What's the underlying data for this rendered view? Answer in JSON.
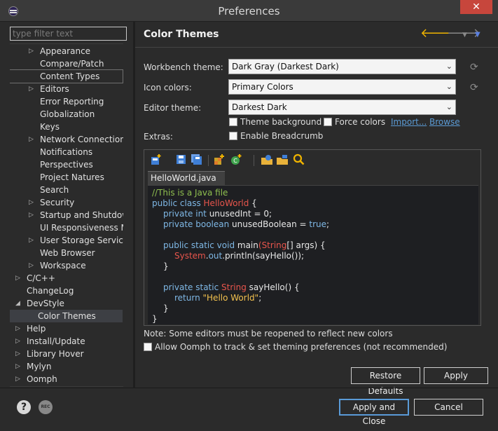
{
  "window": {
    "title": "Preferences",
    "close_label": "✕"
  },
  "filter": {
    "placeholder": "type filter text"
  },
  "tree": [
    {
      "label": "Appearance",
      "arrow": true
    },
    {
      "label": "Compare/Patch",
      "arrow": false
    },
    {
      "label": "Content Types",
      "arrow": false
    },
    {
      "label": "Editors",
      "arrow": true
    },
    {
      "label": "Error Reporting",
      "arrow": false
    },
    {
      "label": "Globalization",
      "arrow": false
    },
    {
      "label": "Keys",
      "arrow": false
    },
    {
      "label": "Network Connections",
      "arrow": true
    },
    {
      "label": "Notifications",
      "arrow": false
    },
    {
      "label": "Perspectives",
      "arrow": false
    },
    {
      "label": "Project Natures",
      "arrow": false
    },
    {
      "label": "Search",
      "arrow": false
    },
    {
      "label": "Security",
      "arrow": true
    },
    {
      "label": "Startup and Shutdown",
      "arrow": true
    },
    {
      "label": "UI Responsiveness Mc",
      "arrow": false
    },
    {
      "label": "User Storage Service",
      "arrow": true
    },
    {
      "label": "Web Browser",
      "arrow": false
    },
    {
      "label": "Workspace",
      "arrow": true
    },
    {
      "label": "C/C++",
      "arrow": true
    },
    {
      "label": "ChangeLog",
      "arrow": false
    },
    {
      "label": "DevStyle",
      "arrow": "open"
    },
    {
      "label": "Color Themes",
      "arrow": false
    },
    {
      "label": "Help",
      "arrow": true
    },
    {
      "label": "Install/Update",
      "arrow": true
    },
    {
      "label": "Library Hover",
      "arrow": true
    },
    {
      "label": "Mylyn",
      "arrow": true
    },
    {
      "label": "Oomph",
      "arrow": true
    }
  ],
  "page": {
    "title": "Color Themes",
    "workbench_theme_label": "Workbench theme:",
    "workbench_theme_value": "Dark Gray (Darkest Dark)",
    "icon_colors_label": "Icon colors:",
    "icon_colors_value": "Primary Colors",
    "editor_theme_label": "Editor theme:",
    "editor_theme_value": "Darkest Dark",
    "theme_background_label": "Theme background",
    "force_colors_label": "Force colors",
    "import_link": "Import...",
    "browse_link": "Browse",
    "extras_label": "Extras:",
    "enable_breadcrumb_label": "Enable Breadcrumb",
    "editor_tab": "HelloWorld.java",
    "note": "Note: Some editors must be reopened to reflect new colors",
    "allow_oomph_label": "Allow Oomph to track & set theming preferences (not recommended)",
    "restore_defaults": "Restore Defaults",
    "apply": "Apply"
  },
  "code": {
    "l1": "//This is a Java file",
    "l2a": "public class ",
    "l2b": "HelloWorld",
    "l2c": " {",
    "l3a": "private int ",
    "l3b": "unusedInt",
    "l3c": " = ",
    "l3d": "0",
    "l3e": ";",
    "l4a": "private boolean ",
    "l4b": "unusedBoolean",
    "l4c": " = ",
    "l4d": "true",
    "l4e": ";",
    "l5a": "public static void ",
    "l5b": "main",
    "l5c": "(",
    "l5d": "String",
    "l5e": "[] args) {",
    "l6a": "System",
    "l6b": ".",
    "l6c": "out",
    "l6d": ".println(sayHello());",
    "l7": "}",
    "l8a": "private static ",
    "l8b": "String",
    "l8c": " sayHello() {",
    "l9a": "return ",
    "l9b": "\"Hello World\"",
    "l9c": ";",
    "l10": "}",
    "l11": "}"
  },
  "footer": {
    "help_icon": "?",
    "rec_icon": "REC",
    "apply_and_close": "Apply and Close",
    "cancel": "Cancel"
  },
  "colors": {
    "accent": "#5a9bd8",
    "back_arrow": "#f0b400",
    "code_comment": "#8fbf4f",
    "code_keyword": "#7fb8e6",
    "code_class": "#e8554c",
    "code_string": "#f2c14e"
  }
}
